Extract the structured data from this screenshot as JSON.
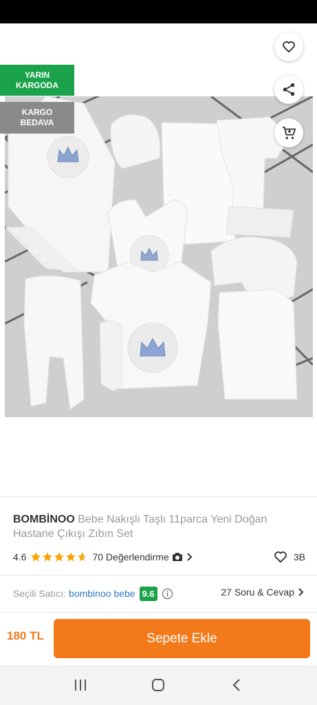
{
  "header": {
    "back_icon": "arrow-left-icon",
    "favorite_icon": "heart-icon",
    "share_icon": "share-icon",
    "cart_icon": "cart-icon"
  },
  "badges": {
    "shipping_line1": "YARIN",
    "shipping_line2": "KARGODA",
    "free_line1": "KARGO",
    "free_line2": "BEDAVA"
  },
  "product": {
    "brand": "BOMBİNOO",
    "name": "Bebe Nakışlı Taşlı 11parca Yeni Doğan Hastane Çıkışı Zıbın Set",
    "rating": "4.6",
    "rating_value": 4.6,
    "stars_max": 5,
    "reviews_label": "70 Değerlendirme",
    "favorites_count": "3B"
  },
  "seller": {
    "label": "Seçili Satıcı:",
    "name": "bombinoo bebe",
    "score": "9.6",
    "qa_label": "27 Soru & Cevap"
  },
  "purchase": {
    "price": "180 TL",
    "add_to_cart_label": "Sepete Ekle"
  },
  "colors": {
    "accent": "#f27a1a",
    "green": "#1aa34a",
    "seller_link": "#2d7cc3",
    "star": "#f7a400"
  }
}
